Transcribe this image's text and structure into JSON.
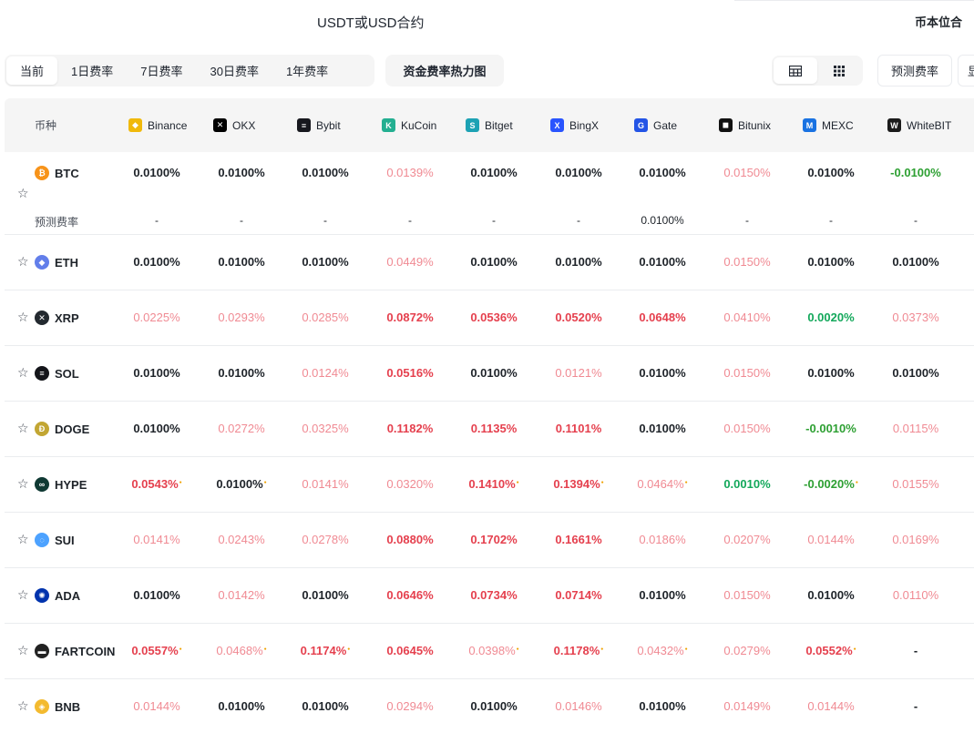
{
  "top_tabs": {
    "usdt_label": "USDT或USD合约",
    "coin_label": "币本位合"
  },
  "toolbar": {
    "periods": [
      {
        "label": "当前",
        "active": true
      },
      {
        "label": "1日费率",
        "active": false
      },
      {
        "label": "7日费率",
        "active": false
      },
      {
        "label": "30日费率",
        "active": false
      },
      {
        "label": "1年费率",
        "active": false
      }
    ],
    "heatmap_label": "资金费率热力图",
    "predict_label": "预测费率",
    "extra_label": "显"
  },
  "table": {
    "coin_header": "币种",
    "exchanges": [
      {
        "name": "Binance",
        "icon": "binance-icon",
        "color": "#f0b90b"
      },
      {
        "name": "OKX",
        "icon": "okx-icon",
        "color": "#000000"
      },
      {
        "name": "Bybit",
        "icon": "bybit-icon",
        "color": "#17181e"
      },
      {
        "name": "KuCoin",
        "icon": "kucoin-icon",
        "color": "#23af91"
      },
      {
        "name": "Bitget",
        "icon": "bitget-icon",
        "color": "#1da2b4"
      },
      {
        "name": "BingX",
        "icon": "bingx-icon",
        "color": "#2954fe"
      },
      {
        "name": "Gate",
        "icon": "gate-icon",
        "color": "#2354e6"
      },
      {
        "name": "Bitunix",
        "icon": "bitunix-icon",
        "color": "#111111"
      },
      {
        "name": "MEXC",
        "icon": "mexc-icon",
        "color": "#1972e2"
      },
      {
        "name": "WhiteBIT",
        "icon": "whitebit-icon",
        "color": "#1b1b1b"
      }
    ],
    "predict_row_label": "预测费率",
    "btc_predicted": [
      "-",
      "-",
      "-",
      "-",
      "-",
      "-",
      "0.0100%",
      "-",
      "-",
      "-"
    ],
    "rows": [
      {
        "coin": "BTC",
        "icon": "btc-icon",
        "color": "#f7931a",
        "values": [
          "0.0100%",
          "0.0100%",
          "0.0100%",
          "0.0139%",
          "0.0100%",
          "0.0100%",
          "0.0100%",
          "0.0150%",
          "0.0100%",
          "-0.0100%"
        ],
        "tones": [
          "n",
          "n",
          "n",
          "l",
          "n",
          "n",
          "n",
          "l",
          "n",
          "gd"
        ],
        "dots": [
          0,
          0,
          0,
          0,
          0,
          0,
          0,
          0,
          0,
          0
        ]
      },
      {
        "coin": "ETH",
        "icon": "eth-icon",
        "color": "#627eea",
        "values": [
          "0.0100%",
          "0.0100%",
          "0.0100%",
          "0.0449%",
          "0.0100%",
          "0.0100%",
          "0.0100%",
          "0.0150%",
          "0.0100%",
          "0.0100%"
        ],
        "tones": [
          "n",
          "n",
          "n",
          "l",
          "n",
          "n",
          "n",
          "l",
          "n",
          "n"
        ],
        "dots": [
          0,
          0,
          0,
          0,
          0,
          0,
          0,
          0,
          0,
          0
        ]
      },
      {
        "coin": "XRP",
        "icon": "xrp-icon",
        "color": "#23292f",
        "values": [
          "0.0225%",
          "0.0293%",
          "0.0285%",
          "0.0872%",
          "0.0536%",
          "0.0520%",
          "0.0648%",
          "0.0410%",
          "0.0020%",
          "0.0373%"
        ],
        "tones": [
          "l",
          "l",
          "l",
          "r",
          "r",
          "r",
          "r",
          "l",
          "g",
          "l"
        ],
        "dots": [
          0,
          0,
          0,
          0,
          0,
          0,
          0,
          0,
          0,
          0
        ]
      },
      {
        "coin": "SOL",
        "icon": "sol-icon",
        "color": "#14151a",
        "values": [
          "0.0100%",
          "0.0100%",
          "0.0124%",
          "0.0516%",
          "0.0100%",
          "0.0121%",
          "0.0100%",
          "0.0150%",
          "0.0100%",
          "0.0100%"
        ],
        "tones": [
          "n",
          "n",
          "l",
          "r",
          "n",
          "l",
          "n",
          "l",
          "n",
          "n"
        ],
        "dots": [
          0,
          0,
          0,
          0,
          0,
          0,
          0,
          0,
          0,
          0
        ]
      },
      {
        "coin": "DOGE",
        "icon": "doge-icon",
        "color": "#c2a633",
        "values": [
          "0.0100%",
          "0.0272%",
          "0.0325%",
          "0.1182%",
          "0.1135%",
          "0.1101%",
          "0.0100%",
          "0.0150%",
          "-0.0010%",
          "0.0115%"
        ],
        "tones": [
          "n",
          "l",
          "l",
          "r",
          "r",
          "r",
          "n",
          "l",
          "gd",
          "l"
        ],
        "dots": [
          0,
          0,
          0,
          0,
          0,
          0,
          0,
          0,
          0,
          0
        ]
      },
      {
        "coin": "HYPE",
        "icon": "hype-icon",
        "color": "#0f3933",
        "values": [
          "0.0543%",
          "0.0100%",
          "0.0141%",
          "0.0320%",
          "0.1410%",
          "0.1394%",
          "0.0464%",
          "0.0010%",
          "-0.0020%",
          "0.0155%"
        ],
        "tones": [
          "r",
          "n",
          "l",
          "l",
          "r",
          "r",
          "l",
          "g",
          "gd",
          "l"
        ],
        "dots": [
          1,
          1,
          0,
          0,
          1,
          1,
          1,
          0,
          1,
          0
        ]
      },
      {
        "coin": "SUI",
        "icon": "sui-icon",
        "color": "#4da2ff",
        "values": [
          "0.0141%",
          "0.0243%",
          "0.0278%",
          "0.0880%",
          "0.1702%",
          "0.1661%",
          "0.0186%",
          "0.0207%",
          "0.0144%",
          "0.0169%"
        ],
        "tones": [
          "l",
          "l",
          "l",
          "r",
          "r",
          "r",
          "l",
          "l",
          "l",
          "l"
        ],
        "dots": [
          0,
          0,
          0,
          0,
          0,
          0,
          0,
          0,
          0,
          0
        ]
      },
      {
        "coin": "ADA",
        "icon": "ada-icon",
        "color": "#0033ad",
        "values": [
          "0.0100%",
          "0.0142%",
          "0.0100%",
          "0.0646%",
          "0.0734%",
          "0.0714%",
          "0.0100%",
          "0.0150%",
          "0.0100%",
          "0.0110%"
        ],
        "tones": [
          "n",
          "l",
          "n",
          "r",
          "r",
          "r",
          "n",
          "l",
          "n",
          "l"
        ],
        "dots": [
          0,
          0,
          0,
          0,
          0,
          0,
          0,
          0,
          0,
          0
        ]
      },
      {
        "coin": "FARTCOIN",
        "icon": "fartcoin-icon",
        "color": "#222222",
        "values": [
          "0.0557%",
          "0.0468%",
          "0.1174%",
          "0.0645%",
          "0.0398%",
          "0.1178%",
          "0.0432%",
          "0.0279%",
          "0.0552%",
          "-"
        ],
        "tones": [
          "r",
          "l",
          "r",
          "r",
          "l",
          "r",
          "l",
          "l",
          "r",
          "n"
        ],
        "dots": [
          1,
          1,
          1,
          0,
          1,
          1,
          1,
          0,
          1,
          0
        ]
      },
      {
        "coin": "BNB",
        "icon": "bnb-icon",
        "color": "#f3ba2f",
        "values": [
          "0.0144%",
          "0.0100%",
          "0.0100%",
          "0.0294%",
          "0.0100%",
          "0.0146%",
          "0.0100%",
          "0.0149%",
          "0.0144%",
          "-"
        ],
        "tones": [
          "l",
          "n",
          "n",
          "l",
          "n",
          "l",
          "n",
          "l",
          "l",
          "n"
        ],
        "dots": [
          0,
          0,
          0,
          0,
          0,
          0,
          0,
          0,
          0,
          0
        ]
      }
    ]
  }
}
